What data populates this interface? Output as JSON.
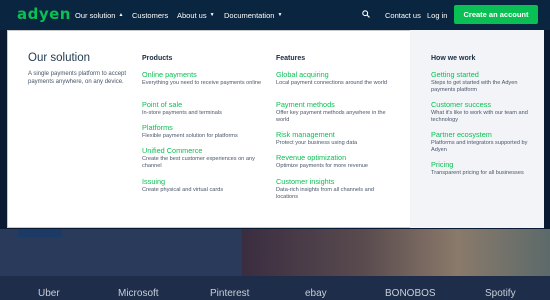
{
  "brand": {
    "logo_text": "adyen",
    "accent": "#0abf53",
    "nav_bg": "#0a2540"
  },
  "nav": {
    "our_solution": "Our solution",
    "customers": "Customers",
    "about_us": "About us",
    "documentation": "Documentation",
    "contact_us": "Contact us",
    "log_in": "Log in",
    "cta": "Create an account"
  },
  "panel": {
    "title": "Our solution",
    "description": "A single payments platform to accept payments anywhere, on any device.",
    "products": {
      "heading": "Products",
      "items": [
        {
          "label": "Online payments",
          "sub": "Everything you need to receive payments online"
        },
        {
          "label": "Point of sale",
          "sub": "In-store payments and terminals"
        },
        {
          "label": "Platforms",
          "sub": "Flexible payment solution for platforms"
        },
        {
          "label": "Unified Commerce",
          "sub": "Create the best customer experiences on any channel"
        },
        {
          "label": "Issuing",
          "sub": "Create physical and virtual cards"
        }
      ]
    },
    "features": {
      "heading": "Features",
      "items": [
        {
          "label": "Global acquiring",
          "sub": "Local payment connections around the world"
        },
        {
          "label": "Payment methods",
          "sub": "Offer key payment methods anywhere in the world"
        },
        {
          "label": "Risk management",
          "sub": "Protect your business using data"
        },
        {
          "label": "Revenue optimization",
          "sub": "Optimize payments for more revenue"
        },
        {
          "label": "Customer insights",
          "sub": "Data-rich insights from all channels and locations"
        }
      ]
    },
    "how": {
      "heading": "How we work",
      "items": [
        {
          "label": "Getting started",
          "sub": "Steps to get started with the Adyen payments platform"
        },
        {
          "label": "Customer success",
          "sub": "What it's like to work with our team and technology"
        },
        {
          "label": "Partner ecosystem",
          "sub": "Platforms and integrators supported by Adyen"
        },
        {
          "label": "Pricing",
          "sub": "Transparent pricing for all businesses"
        }
      ]
    }
  },
  "logos": [
    "Uber",
    "Microsoft",
    "Pinterest",
    "ebay",
    "BONOBOS",
    "Spotify"
  ]
}
